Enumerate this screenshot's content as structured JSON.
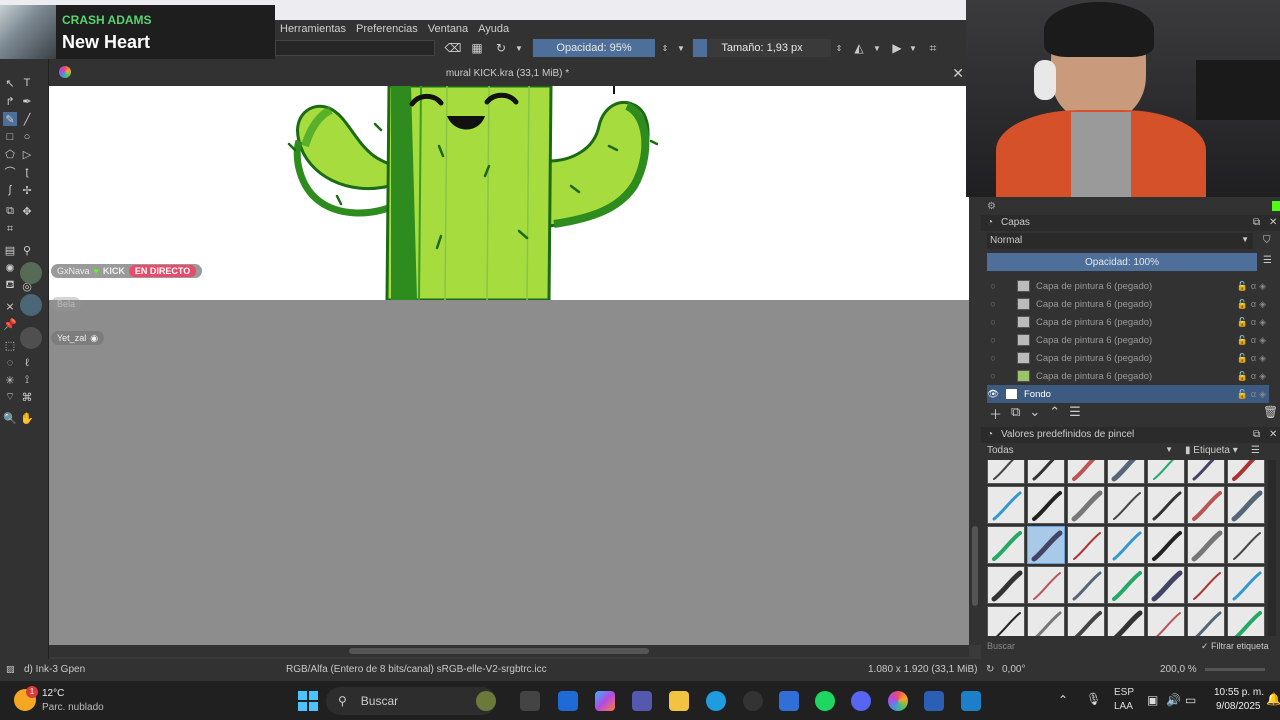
{
  "menu": [
    "Herramientas",
    "Preferencias",
    "Ventana",
    "Ayuda"
  ],
  "toolbar": {
    "opacity_label": "Opacidad: 95%",
    "size_label": "Tamaño: 1,93 px"
  },
  "song": {
    "artist": "CRASH ADAMS",
    "title": "New Heart"
  },
  "document": {
    "title": "mural KICK.kra (33,1 MiB) *"
  },
  "chat": {
    "user1": "GxNava",
    "platform": "KICK",
    "live": "EN DIRECTO",
    "user2": "Bela",
    "user3": "Yet_zal"
  },
  "layers_panel": {
    "title": "Capas",
    "blend_mode": "Normal",
    "opacity": "Opacidad:  100%",
    "layers": [
      "Capa de pintura 6 (pegado)",
      "Capa de pintura 6 (pegado)",
      "Capa de pintura 6 (pegado)",
      "Capa de pintura 6 (pegado)",
      "Capa de pintura 6 (pegado)",
      "Capa de pintura 6 (pegado)",
      "Fondo"
    ]
  },
  "brush_panel": {
    "title": "Valores predefinidos de pincel",
    "filter": "Todas",
    "tag": "Etiqueta",
    "search_placeholder": "Buscar",
    "filter_tag": "Filtrar etiqueta"
  },
  "status": {
    "brush": "d) Ink-3 Gpen",
    "color": "RGB/Alfa (Entero de 8 bits/canal)  sRGB-elle-V2-srgbtrc.icc",
    "dims": "1.080 x 1.920 (33,1 MiB)",
    "rotation": "0,00°",
    "zoom": "200,0 %"
  },
  "taskbar": {
    "temp": "12°C",
    "weather": "Parc. nublado",
    "search": "Buscar",
    "lang1": "ESP",
    "lang2": "LAA",
    "time": "10:55 p. m.",
    "date": "9/08/2025",
    "weather_badge": "1"
  },
  "colors": {
    "accent": "#4d6f99",
    "selected": "#3d5a80",
    "kick": "#53fc18",
    "live": "#e94c6a"
  }
}
